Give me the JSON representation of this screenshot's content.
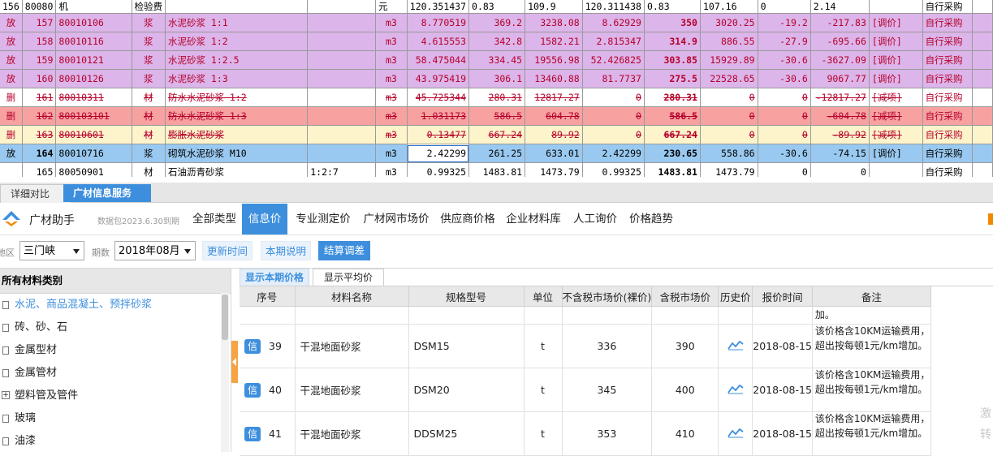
{
  "top_grid": {
    "first_row": [
      "156",
      "80080",
      "机",
      "检验费",
      "",
      "",
      "元",
      "120.351437",
      "0.83",
      "109.9",
      "120.311438",
      "0.83",
      "107.16",
      "0",
      "2.14",
      "",
      "自行采购"
    ],
    "rows": [
      {
        "mark": "放",
        "seq": "157",
        "code": "80010106",
        "type": "浆",
        "name": "水泥砂浆 1:1",
        "spec": "",
        "unit": "m3",
        "qty": "8.770519",
        "p1": "369.2",
        "p2": "3238.08",
        "p3": "8.62929",
        "p4": "350",
        "p5": "3020.25",
        "p6": "-19.2",
        "p7": "-217.83",
        "op": "[调价]",
        "src": "自行采购"
      },
      {
        "mark": "放",
        "seq": "158",
        "code": "80010116",
        "type": "浆",
        "name": "水泥砂浆 1:2",
        "spec": "",
        "unit": "m3",
        "qty": "4.615553",
        "p1": "342.8",
        "p2": "1582.21",
        "p3": "2.815347",
        "p4": "314.9",
        "p5": "886.55",
        "p6": "-27.9",
        "p7": "-695.66",
        "op": "[调价]",
        "src": "自行采购"
      },
      {
        "mark": "放",
        "seq": "159",
        "code": "80010121",
        "type": "浆",
        "name": "水泥砂浆 1:2.5",
        "spec": "",
        "unit": "m3",
        "qty": "58.475044",
        "p1": "334.45",
        "p2": "19556.98",
        "p3": "52.426825",
        "p4": "303.85",
        "p5": "15929.89",
        "p6": "-30.6",
        "p7": "-3627.09",
        "op": "[调价]",
        "src": "自行采购"
      },
      {
        "mark": "放",
        "seq": "160",
        "code": "80010126",
        "type": "浆",
        "name": "水泥砂浆 1:3",
        "spec": "",
        "unit": "m3",
        "qty": "43.975419",
        "p1": "306.1",
        "p2": "13460.88",
        "p3": "81.7737",
        "p4": "275.5",
        "p5": "22528.65",
        "p6": "-30.6",
        "p7": "9067.77",
        "op": "[调价]",
        "src": "自行采购"
      },
      {
        "mark": "删",
        "seq": "161",
        "code": "80010311",
        "type": "材",
        "name": "防水水泥砂浆 1:2",
        "spec": "",
        "unit": "m3",
        "qty": "45.725344",
        "p1": "280.31",
        "p2": "12817.27",
        "p3": "0",
        "p4": "280.31",
        "p5": "0",
        "p6": "0",
        "p7": "-12817.27",
        "op": "[减项]",
        "src": "自行采购"
      },
      {
        "mark": "删",
        "seq": "162",
        "code": "800103101",
        "type": "材",
        "name": "防水水泥砂浆 1:3",
        "spec": "",
        "unit": "m3",
        "qty": "1.031173",
        "p1": "586.5",
        "p2": "604.78",
        "p3": "0",
        "p4": "586.5",
        "p5": "0",
        "p6": "0",
        "p7": "-604.78",
        "op": "[减项]",
        "src": "自行采购"
      },
      {
        "mark": "删",
        "seq": "163",
        "code": "80010601",
        "type": "材",
        "name": "膨胀水泥砂浆",
        "spec": "",
        "unit": "m3",
        "qty": "0.13477",
        "p1": "667.24",
        "p2": "89.92",
        "p3": "0",
        "p4": "667.24",
        "p5": "0",
        "p6": "0",
        "p7": "-89.92",
        "op": "[减项]",
        "src": "自行采购"
      },
      {
        "mark": "放",
        "seq": "164",
        "code": "80010716",
        "type": "浆",
        "name": "砌筑水泥砂浆 M10",
        "spec": "",
        "unit": "m3",
        "qty": "2.42299",
        "p1": "261.25",
        "p2": "633.01",
        "p3": "2.42299",
        "p4": "230.65",
        "p5": "558.86",
        "p6": "-30.6",
        "p7": "-74.15",
        "op": "[调价]",
        "src": "自行采购"
      },
      {
        "mark": "",
        "seq": "165",
        "code": "80050901",
        "type": "材",
        "name": "石油沥青砂浆",
        "spec": "1:2:7",
        "unit": "m3",
        "qty": "0.99325",
        "p1": "1483.81",
        "p2": "1473.79",
        "p3": "0.99325",
        "p4": "1483.81",
        "p5": "1473.79",
        "p6": "0",
        "p7": "0",
        "op": "",
        "src": "自行采购"
      }
    ]
  },
  "tabs": {
    "detail": "详细对比",
    "info": "广材信息服务"
  },
  "nav": {
    "brand": "广材助手",
    "package": "数据包2023.6.30到期",
    "items": [
      "全部类型",
      "信息价",
      "专业测定价",
      "广材网市场价",
      "供应商价格",
      "企业材料库",
      "人工询价",
      "价格趋势"
    ],
    "active_index": 1
  },
  "filter": {
    "region_label": "地区",
    "region_value": "三门峡",
    "period_label": "期数",
    "period_value": "2018年08月",
    "btn_update": "更新时间",
    "btn_desc": "本期说明",
    "btn_calc": "结算调差"
  },
  "left": {
    "header": "所有材料类别",
    "categories": [
      {
        "label": "水泥、商品混凝土、预拌砂浆",
        "active": true,
        "icon": "file-icon"
      },
      {
        "label": "砖、砂、石",
        "active": false,
        "icon": "file-icon"
      },
      {
        "label": "金属型材",
        "active": false,
        "icon": "file-icon"
      },
      {
        "label": "金属管材",
        "active": false,
        "icon": "file-icon"
      },
      {
        "label": "塑料管及管件",
        "active": false,
        "icon": "expand-icon"
      },
      {
        "label": "玻璃",
        "active": false,
        "icon": "file-icon"
      },
      {
        "label": "油漆",
        "active": false,
        "icon": "file-icon"
      }
    ]
  },
  "right": {
    "sub_tabs": [
      "显示本期价格",
      "显示平均价"
    ],
    "headers": [
      "序号",
      "材料名称",
      "规格型号",
      "单位",
      "不含税市场价(裸价)",
      "含税市场价",
      "历史价",
      "报价时间",
      "备注"
    ],
    "partial_note": "加。",
    "badge": "信",
    "rows": [
      {
        "seq": "39",
        "name": "干混地面砂浆",
        "spec": "DSM15",
        "unit": "t",
        "price_ex": "336",
        "price_in": "390",
        "date": "2018-08-15",
        "note": "该价格含10KM运输费用，超出按每顿1元/km增加。"
      },
      {
        "seq": "40",
        "name": "干混地面砂浆",
        "spec": "DSM20",
        "unit": "t",
        "price_ex": "345",
        "price_in": "400",
        "date": "2018-08-15",
        "note": "该价格含10KM运输费用，超出按每顿1元/km增加。"
      },
      {
        "seq": "41",
        "name": "干混地面砂浆",
        "spec": "DDSM25",
        "unit": "t",
        "price_ex": "353",
        "price_in": "410",
        "date": "2018-08-15",
        "note": "该价格含10KM运输费用，超出按每顿1元/km增加。"
      }
    ]
  },
  "watermark": "激\n转"
}
